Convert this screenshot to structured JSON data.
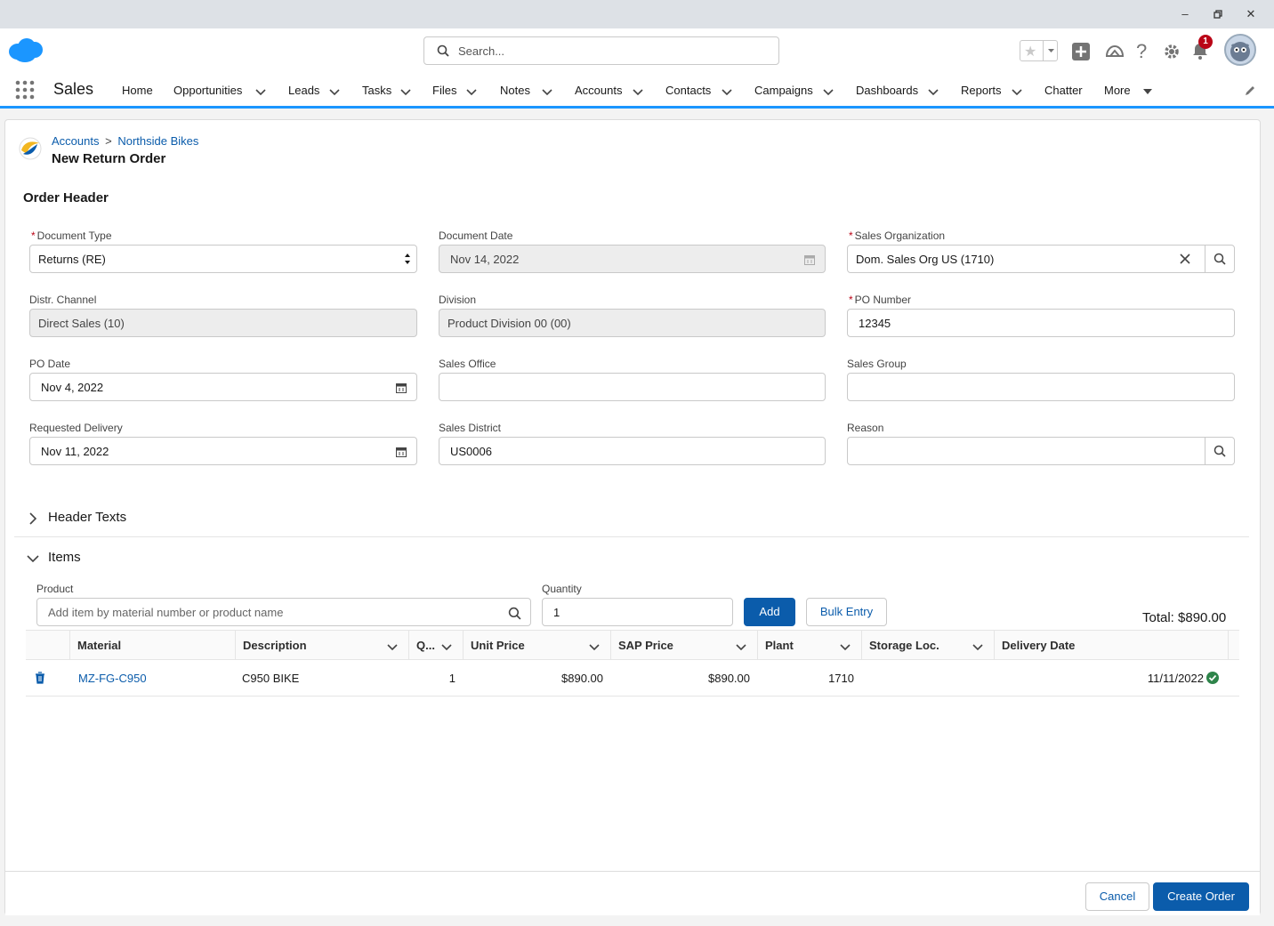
{
  "header": {
    "search_placeholder": "Search...",
    "notification_count": "1"
  },
  "nav": {
    "app_name": "Sales",
    "items": [
      {
        "label": "Home"
      },
      {
        "label": "Opportunities"
      },
      {
        "label": "Leads"
      },
      {
        "label": "Tasks"
      },
      {
        "label": "Files"
      },
      {
        "label": "Notes"
      },
      {
        "label": "Accounts"
      },
      {
        "label": "Contacts"
      },
      {
        "label": "Campaigns"
      },
      {
        "label": "Dashboards"
      },
      {
        "label": "Reports"
      },
      {
        "label": "Chatter"
      },
      {
        "label": "More"
      }
    ]
  },
  "page": {
    "breadcrumb": {
      "parent": "Accounts",
      "separator": ">",
      "record": "Northside Bikes"
    },
    "title": "New Return Order",
    "section_title": "Order Header"
  },
  "form": {
    "document_type": {
      "label": "Document Type",
      "value": "Returns (RE)"
    },
    "document_date": {
      "label": "Document Date",
      "value": "Nov 14, 2022"
    },
    "sales_org": {
      "label": "Sales Organization",
      "value": "Dom. Sales Org US (1710)"
    },
    "distr_channel": {
      "label": "Distr. Channel",
      "value": "Direct Sales (10)"
    },
    "division": {
      "label": "Division",
      "value": "Product Division 00 (00)"
    },
    "po_number": {
      "label": "PO Number",
      "value": "12345"
    },
    "po_date": {
      "label": "PO Date",
      "value": "Nov 4, 2022"
    },
    "sales_office": {
      "label": "Sales Office",
      "value": ""
    },
    "sales_group": {
      "label": "Sales Group",
      "value": ""
    },
    "requested_delivery": {
      "label": "Requested Delivery",
      "value": "Nov 11, 2022"
    },
    "sales_district": {
      "label": "Sales District",
      "value": "US0006"
    },
    "reason": {
      "label": "Reason",
      "value": ""
    }
  },
  "sections": {
    "header_texts": "Header Texts",
    "items": "Items"
  },
  "items": {
    "product_label": "Product",
    "product_placeholder": "Add item by material number or product name",
    "quantity_label": "Quantity",
    "quantity_value": "1",
    "add_label": "Add",
    "bulk_label": "Bulk Entry",
    "total": "Total: $890.00",
    "columns": [
      "Material",
      "Description",
      "Q...",
      "Unit Price",
      "SAP Price",
      "Plant",
      "Storage Loc.",
      "Delivery Date"
    ],
    "rows": [
      {
        "material": "MZ-FG-C950",
        "description": "C950 BIKE",
        "quantity": "1",
        "unit_price": "$890.00",
        "sap_price": "$890.00",
        "plant": "1710",
        "storage_loc": "",
        "delivery_date": "11/11/2022"
      }
    ]
  },
  "footer": {
    "cancel": "Cancel",
    "create": "Create Order"
  },
  "colors": {
    "brand": "#0b5cab",
    "nav_accent": "#1b96ff",
    "required": "#ba0517",
    "success": "#2e844a"
  }
}
